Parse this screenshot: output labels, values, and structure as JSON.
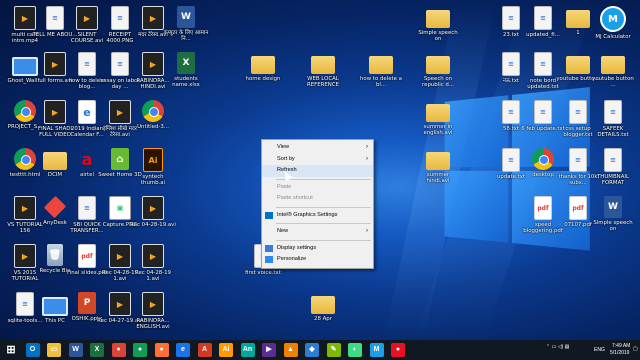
{
  "desktop": {
    "icons": [
      {
        "label": "multi care intro.mp4",
        "type": "video",
        "col": 0,
        "row": 0
      },
      {
        "label": "TELL ME ABOU...",
        "type": "file",
        "col": 1,
        "row": 0
      },
      {
        "label": "SILENT COURSE.avi",
        "type": "video",
        "col": 2,
        "row": 0
      },
      {
        "label": "RECEIPT 4000.PNG",
        "type": "file",
        "col": 3,
        "row": 0
      },
      {
        "label": "मदर टेरेसा.avi",
        "type": "video",
        "col": 4,
        "row": 0
      },
      {
        "label": "कंप्यूटर के लिए आसान नि...",
        "type": "word",
        "col": 5,
        "row": 0
      },
      {
        "label": "Ghost_Wall...",
        "type": "pc",
        "col": 0,
        "row": 1
      },
      {
        "label": "full forms.avi",
        "type": "video",
        "col": 1,
        "row": 1
      },
      {
        "label": "how to delete blog...",
        "type": "file",
        "col": 2,
        "row": 1
      },
      {
        "label": "essay on labor day ...",
        "type": "file",
        "col": 3,
        "row": 1
      },
      {
        "label": "RABINDRA... HINDI.avi",
        "type": "video",
        "col": 4,
        "row": 1
      },
      {
        "label": "students name.xlsx",
        "type": "excel",
        "col": 5,
        "row": 1
      },
      {
        "label": "PROJECT_S...",
        "type": "chrome",
        "col": 0,
        "row": 2
      },
      {
        "label": "FINAL SHADI FULL VIDEO",
        "type": "video",
        "col": 1,
        "row": 2
      },
      {
        "label": "2019 Indian Calendar F...",
        "type": "edge",
        "col": 2,
        "row": 2
      },
      {
        "label": "इंग्लिश सीखे मदर टेरेसा.avi",
        "type": "video",
        "col": 3,
        "row": 2
      },
      {
        "label": "Untitled-3...",
        "type": "chrome",
        "col": 4,
        "row": 2
      },
      {
        "label": "testttt.html",
        "type": "chrome",
        "col": 0,
        "row": 3
      },
      {
        "label": "DCIM",
        "type": "folder",
        "col": 1,
        "row": 3
      },
      {
        "label": "airtel",
        "type": "airtel",
        "col": 2,
        "row": 3
      },
      {
        "label": "Sweet Home 3D",
        "type": "sweet",
        "col": 3,
        "row": 3
      },
      {
        "label": "syntech thumb.ai",
        "type": "ai",
        "col": 4,
        "row": 3
      },
      {
        "label": "VS TUTORIAL 156",
        "type": "video",
        "col": 0,
        "row": 4
      },
      {
        "label": "AnyDesk",
        "type": "anydesk",
        "col": 1,
        "row": 4
      },
      {
        "label": "SBI QUICK TRANSFER...",
        "type": "file",
        "col": 2,
        "row": 4
      },
      {
        "label": "Capture.PNG",
        "type": "cap",
        "col": 3,
        "row": 4
      },
      {
        "label": "Rec 04-28-19.avi",
        "type": "video",
        "col": 4,
        "row": 4
      },
      {
        "label": "VS 2015 TUTORIAL",
        "type": "video",
        "col": 0,
        "row": 5
      },
      {
        "label": "Recycle Bin",
        "type": "bin",
        "col": 1,
        "row": 5
      },
      {
        "label": "Final slides.pdf",
        "type": "pdf",
        "col": 2,
        "row": 5
      },
      {
        "label": "Rec 04-28-19 1.avi",
        "type": "video",
        "col": 3,
        "row": 5
      },
      {
        "label": "Rec 04-28-19 1.avi",
        "type": "video",
        "col": 4,
        "row": 5
      },
      {
        "label": "sqlite-tools...",
        "type": "file",
        "col": 0,
        "row": 6
      },
      {
        "label": "This PC",
        "type": "pc",
        "col": 1,
        "row": 6
      },
      {
        "label": "OSHIK.pptx",
        "type": "ppt",
        "col": 2,
        "row": 6
      },
      {
        "label": "Rec 04-27-19.avi",
        "type": "video",
        "col": 3,
        "row": 6
      },
      {
        "label": "RABINDRA... ENGLISH.avi",
        "type": "video",
        "col": 4,
        "row": 6
      },
      {
        "label": "home design",
        "type": "folder",
        "col": 6,
        "row": 1
      },
      {
        "label": "WEB LOCAL REFERENCE",
        "type": "folder",
        "col": 8,
        "row": 1
      },
      {
        "label": "how to delete a bl...",
        "type": "folder",
        "col": 9,
        "row": 1
      },
      {
        "label": "Speech on republic d...",
        "type": "folder",
        "col": 10,
        "row": 1
      },
      {
        "label": "Simple speech on",
        "type": "folder",
        "col": 10,
        "row": 0
      },
      {
        "label": "23.txt",
        "type": "file",
        "col": 11,
        "row": 0
      },
      {
        "label": "updated_fi...",
        "type": "file",
        "col": 12,
        "row": 0
      },
      {
        "label": "1",
        "type": "folder",
        "col": 13,
        "row": 0
      },
      {
        "label": "MJ Calculator",
        "type": "calc",
        "col": 14,
        "row": 0
      },
      {
        "label": "नऊ.txt",
        "type": "file",
        "col": 11,
        "row": 1
      },
      {
        "label": "note bord updated.txt",
        "type": "file",
        "col": 12,
        "row": 1
      },
      {
        "label": "youtube butto...",
        "type": "folder",
        "col": 13,
        "row": 1
      },
      {
        "label": "youtube button ...",
        "type": "folder",
        "col": 14,
        "row": 1
      },
      {
        "label": "summer in english.avi",
        "type": "folder",
        "col": 10,
        "row": 2
      },
      {
        "label": "58.txt",
        "type": "file",
        "col": 11,
        "row": 2
      },
      {
        "label": "6 feb update.txt",
        "type": "file",
        "col": 12,
        "row": 2
      },
      {
        "label": "css setup blogger.txt",
        "type": "file",
        "col": 13,
        "row": 2
      },
      {
        "label": "SAFEEK DETAILS.txt",
        "type": "file",
        "col": 14,
        "row": 2
      },
      {
        "label": "summer hindi.avi",
        "type": "folder",
        "col": 10,
        "row": 3
      },
      {
        "label": "update.txt",
        "type": "file",
        "col": 11,
        "row": 3
      },
      {
        "label": "desktop",
        "type": "chrome",
        "col": 12,
        "row": 3
      },
      {
        "label": "thanks for 10k subs...",
        "type": "file",
        "col": 13,
        "row": 3
      },
      {
        "label": "THUMBNAIL FORMAT",
        "type": "file",
        "col": 14,
        "row": 3
      },
      {
        "label": "speed bloggering.pdf",
        "type": "pdf",
        "col": 12,
        "row": 4
      },
      {
        "label": "07107.pdf",
        "type": "pdf",
        "col": 13,
        "row": 4
      },
      {
        "label": "Simple speech on",
        "type": "word",
        "col": 14,
        "row": 4
      },
      {
        "label": "first voice.txt",
        "type": "file",
        "col": 6,
        "row": 5
      },
      {
        "label": "28 Apr",
        "type": "folder",
        "col": 8,
        "row": 6
      }
    ]
  },
  "context_menu": {
    "items": [
      {
        "label": "View",
        "kind": "submenu"
      },
      {
        "label": "Sort by",
        "kind": "submenu"
      },
      {
        "label": "Refresh",
        "kind": "highlighted"
      },
      {
        "label": "",
        "kind": "separator"
      },
      {
        "label": "Paste",
        "kind": "disabled"
      },
      {
        "label": "Paste shortcut",
        "kind": "disabled"
      },
      {
        "label": "",
        "kind": "separator"
      },
      {
        "label": "Intel® Graphics Settings",
        "kind": "icon",
        "icon": "intel-icon"
      },
      {
        "label": "",
        "kind": "separator"
      },
      {
        "label": "New",
        "kind": "submenu"
      },
      {
        "label": "",
        "kind": "separator"
      },
      {
        "label": "Display settings",
        "kind": "icon",
        "icon": "display-icon"
      },
      {
        "label": "Personalize",
        "kind": "icon",
        "icon": "personalize-icon"
      }
    ]
  },
  "taskbar": {
    "apps": [
      {
        "name": "start-icon",
        "color": "#ffffff",
        "glyph": "⊞"
      },
      {
        "name": "outlook-icon",
        "color": "#0072c6",
        "glyph": "O"
      },
      {
        "name": "file-explorer-icon",
        "color": "#f0c040",
        "glyph": "▭"
      },
      {
        "name": "word-icon",
        "color": "#2b579a",
        "glyph": "W"
      },
      {
        "name": "excel-icon",
        "color": "#1d6f42",
        "glyph": "X"
      },
      {
        "name": "chrome-icon",
        "color": "#db4437",
        "glyph": "●"
      },
      {
        "name": "chrome-icon-2",
        "color": "#0f9d58",
        "glyph": "●"
      },
      {
        "name": "firefox-icon",
        "color": "#ff7139",
        "glyph": "●"
      },
      {
        "name": "edge-icon",
        "color": "#1a73e8",
        "glyph": "e"
      },
      {
        "name": "adobe-icon",
        "color": "#d23a25",
        "glyph": "A"
      },
      {
        "name": "illustrator-icon",
        "color": "#ff9a00",
        "glyph": "Ai"
      },
      {
        "name": "animate-icon",
        "color": "#00a79d",
        "glyph": "An"
      },
      {
        "name": "media-icon",
        "color": "#5c2d91",
        "glyph": "▶"
      },
      {
        "name": "vlc-icon",
        "color": "#f08000",
        "glyph": "▲"
      },
      {
        "name": "photos-icon",
        "color": "#2d7dd2",
        "glyph": "◆"
      },
      {
        "name": "paint-icon",
        "color": "#7fba00",
        "glyph": "✎"
      },
      {
        "name": "android-icon",
        "color": "#3ddc84",
        "glyph": "◐"
      },
      {
        "name": "calc-icon",
        "color": "#1aa0e8",
        "glyph": "M"
      },
      {
        "name": "screen-icon",
        "color": "#e81123",
        "glyph": "●"
      }
    ],
    "language": "ENG",
    "time": "7:49 AM",
    "date": "5/1/2019"
  }
}
